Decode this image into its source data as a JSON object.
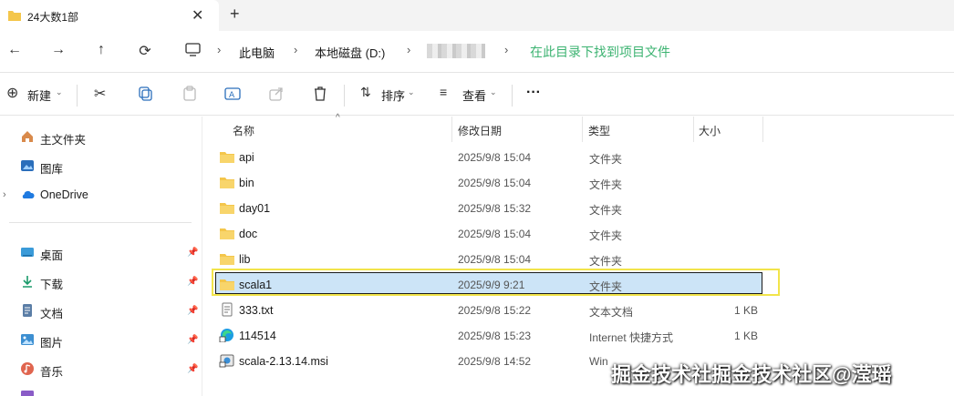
{
  "tab": {
    "title": "24大数1部",
    "close": "✕",
    "new_tab": "+"
  },
  "breadcrumb": {
    "items": [
      "此电脑",
      "本地磁盘 (D:)"
    ],
    "annotation": "在此目录下找到项目文件"
  },
  "toolbar": {
    "new_label": "新建",
    "sort_label": "排序",
    "view_label": "查看",
    "more": "···"
  },
  "sidebar": {
    "items": [
      {
        "label": "主文件夹",
        "icon": "home-icon"
      },
      {
        "label": "图库",
        "icon": "gallery-icon"
      },
      {
        "label": "OneDrive",
        "icon": "cloud-icon"
      },
      {
        "label": "桌面",
        "icon": "desktop-icon"
      },
      {
        "label": "下载",
        "icon": "download-icon"
      },
      {
        "label": "文档",
        "icon": "document-icon"
      },
      {
        "label": "图片",
        "icon": "picture-icon"
      },
      {
        "label": "音乐",
        "icon": "music-icon"
      }
    ]
  },
  "columns": {
    "name": "名称",
    "date": "修改日期",
    "type": "类型",
    "size": "大小"
  },
  "files": [
    {
      "name": "api",
      "date": "2025/9/8 15:04",
      "type": "文件夹",
      "size": "",
      "icon": "folder-icon"
    },
    {
      "name": "bin",
      "date": "2025/9/8 15:04",
      "type": "文件夹",
      "size": "",
      "icon": "folder-icon"
    },
    {
      "name": "day01",
      "date": "2025/9/8 15:32",
      "type": "文件夹",
      "size": "",
      "icon": "folder-icon"
    },
    {
      "name": "doc",
      "date": "2025/9/8 15:04",
      "type": "文件夹",
      "size": "",
      "icon": "folder-icon"
    },
    {
      "name": "lib",
      "date": "2025/9/8 15:04",
      "type": "文件夹",
      "size": "",
      "icon": "folder-icon"
    },
    {
      "name": "scala1",
      "date": "2025/9/9 9:21",
      "type": "文件夹",
      "size": "",
      "icon": "folder-icon"
    },
    {
      "name": "333.txt",
      "date": "2025/9/8 15:22",
      "type": "文本文档",
      "size": "1 KB",
      "icon": "text-file-icon"
    },
    {
      "name": "114514",
      "date": "2025/9/8 15:23",
      "type": "Internet 快捷方式",
      "size": "1 KB",
      "icon": "edge-shortcut-icon"
    },
    {
      "name": "scala-2.13.14.msi",
      "date": "2025/9/8 14:52",
      "type": "Win",
      "size": "",
      "icon": "installer-icon"
    }
  ],
  "watermark": "掘金技术社掘金技术社区@滢瑶",
  "colors": {
    "selection": "#cce4f7",
    "highlight_box": "#f2e44a",
    "annotation": "#3cb371",
    "folder": "#f4c64b"
  }
}
